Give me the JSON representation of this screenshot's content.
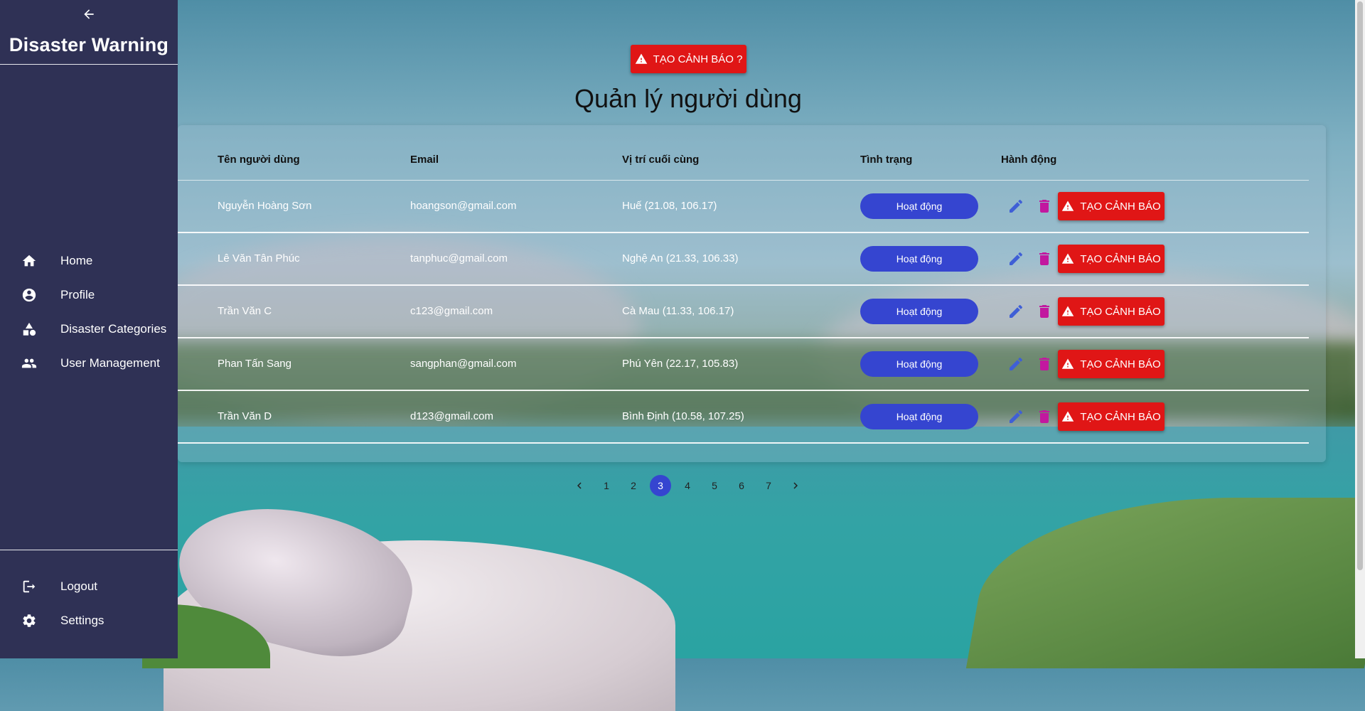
{
  "sidebar": {
    "brand": "Disaster Warning",
    "nav": [
      {
        "label": "Home",
        "icon": "home-icon"
      },
      {
        "label": "Profile",
        "icon": "account-circle-icon"
      },
      {
        "label": "Disaster Categories",
        "icon": "category-shapes-icon"
      },
      {
        "label": "User Management",
        "icon": "people-icon"
      }
    ],
    "bottom": [
      {
        "label": "Logout",
        "icon": "logout-icon"
      },
      {
        "label": "Settings",
        "icon": "gear-icon"
      }
    ]
  },
  "main": {
    "top_alert_label": "TẠO CẢNH BÁO ?",
    "title": "Quản lý người dùng",
    "columns": [
      "Tên người dùng",
      "Email",
      "Vị trí cuối cùng",
      "Tình trạng",
      "Hành động"
    ],
    "rows": [
      {
        "name": "Nguyễn Hoàng Sơn",
        "email": "hoangson@gmail.com",
        "location": "Huế (21.08, 106.17)",
        "status": "Hoạt động",
        "alert": "TẠO CẢNH BÁO"
      },
      {
        "name": "Lê Văn Tân Phúc",
        "email": "tanphuc@gmail.com",
        "location": "Nghệ An (21.33, 106.33)",
        "status": "Hoạt động",
        "alert": "TẠO CẢNH BÁO"
      },
      {
        "name": "Trần Văn C",
        "email": "c123@gmail.com",
        "location": "Cà Mau (11.33, 106.17)",
        "status": "Hoạt động",
        "alert": "TẠO CẢNH BÁO"
      },
      {
        "name": "Phan Tấn Sang",
        "email": "sangphan@gmail.com",
        "location": "Phú Yên (22.17, 105.83)",
        "status": "Hoạt động",
        "alert": "TẠO CẢNH BÁO"
      },
      {
        "name": "Trần Văn D",
        "email": "d123@gmail.com",
        "location": "Bình Định (10.58, 107.25)",
        "status": "Hoạt động",
        "alert": "TẠO CẢNH BÁO"
      }
    ],
    "pagination": {
      "pages": [
        "1",
        "2",
        "3",
        "4",
        "5",
        "6",
        "7"
      ],
      "current": "3"
    }
  },
  "colors": {
    "sidebar_bg": "#2f3155",
    "status_blue": "#3545d0",
    "alert_red": "#e01616",
    "edit_icon": "#3f5fd6",
    "delete_icon": "#c2189f"
  }
}
